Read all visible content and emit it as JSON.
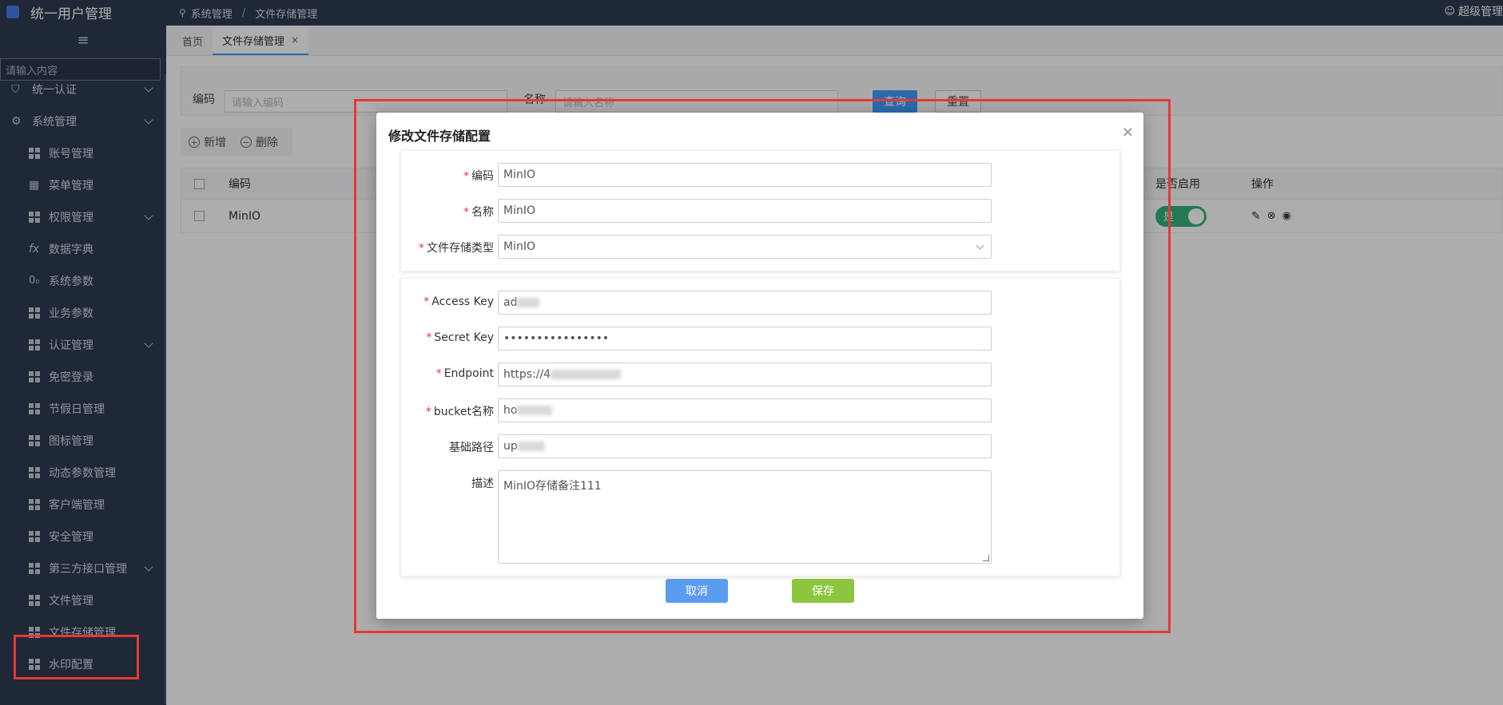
{
  "app": {
    "title": "统一用户管理"
  },
  "sidebar": {
    "search_placeholder": "请输入内容",
    "items": [
      {
        "label": "统一认证",
        "level": "top",
        "icon": "shield-icon",
        "expandable": true
      },
      {
        "label": "系统管理",
        "level": "top",
        "icon": "gear-icon",
        "expandable": true
      },
      {
        "label": "账号管理",
        "level": "sub",
        "icon": "grid-icon",
        "expandable": false
      },
      {
        "label": "菜单管理",
        "level": "sub",
        "icon": "table-icon",
        "expandable": false
      },
      {
        "label": "权限管理",
        "level": "sub",
        "icon": "grid-icon",
        "expandable": true
      },
      {
        "label": "数据字典",
        "level": "sub",
        "icon": "fx-icon",
        "expandable": false
      },
      {
        "label": "系统参数",
        "level": "sub",
        "icon": "toggle-icon",
        "expandable": false
      },
      {
        "label": "业务参数",
        "level": "sub",
        "icon": "grid-icon",
        "expandable": false
      },
      {
        "label": "认证管理",
        "level": "sub",
        "icon": "grid-icon",
        "expandable": true
      },
      {
        "label": "免密登录",
        "level": "sub",
        "icon": "grid-icon",
        "expandable": false
      },
      {
        "label": "节假日管理",
        "level": "sub",
        "icon": "grid-icon",
        "expandable": false
      },
      {
        "label": "图标管理",
        "level": "sub",
        "icon": "grid-icon",
        "expandable": false
      },
      {
        "label": "动态参数管理",
        "level": "sub",
        "icon": "grid-icon",
        "expandable": false
      },
      {
        "label": "客户端管理",
        "level": "sub",
        "icon": "grid-icon",
        "expandable": false
      },
      {
        "label": "安全管理",
        "level": "sub",
        "icon": "grid-icon",
        "expandable": false
      },
      {
        "label": "第三方接口管理",
        "level": "sub",
        "icon": "grid-icon",
        "expandable": true
      },
      {
        "label": "文件管理",
        "level": "sub",
        "icon": "grid-icon",
        "expandable": false
      },
      {
        "label": "文件存储管理",
        "level": "sub",
        "icon": "grid-icon",
        "expandable": false
      },
      {
        "label": "水印配置",
        "level": "sub",
        "icon": "grid-icon",
        "expandable": false
      }
    ]
  },
  "header": {
    "breadcrumb": [
      "系统管理",
      "文件存储管理"
    ],
    "breadcrumb_sep": "/",
    "user": "超级管理"
  },
  "tabs": [
    {
      "label": "首页"
    },
    {
      "label": "文件存储管理",
      "close": "×"
    }
  ],
  "filter": {
    "code_label": "编码",
    "code_placeholder": "请输入编码",
    "name_label": "名称",
    "name_placeholder": "请输入名称",
    "query_button": "查询",
    "reset_button": "重置"
  },
  "toolbar": {
    "add_label": "新增",
    "delete_label": "删除"
  },
  "table": {
    "columns": {
      "code": "编码",
      "enabled": "是否启用",
      "actions": "操作"
    },
    "rows": [
      {
        "code": "MinIO",
        "enabled": "是"
      }
    ]
  },
  "dialog": {
    "title": "修改文件存储配置",
    "close": "×",
    "fields": {
      "code": {
        "label": "编码",
        "value": "MinIO"
      },
      "name": {
        "label": "名称",
        "value": "MinIO"
      },
      "type": {
        "label": "文件存储类型",
        "value": "MinIO"
      },
      "access_key": {
        "label": "Access Key",
        "value": "ad"
      },
      "secret_key": {
        "label": "Secret Key",
        "value": "••••••••••••••••"
      },
      "endpoint": {
        "label": "Endpoint",
        "value": "https://4"
      },
      "bucket": {
        "label": "bucket名称",
        "value": "ho"
      },
      "base_path": {
        "label": "基础路径",
        "value": "up"
      },
      "description": {
        "label": "描述",
        "value": "MinIO存储备注111"
      }
    },
    "cancel_button": "取消",
    "save_button": "保存"
  },
  "colors": {
    "sidebar_bg": "#2f3b52",
    "accent": "#409eff",
    "cancel_btn": "#5b9bf0",
    "save_btn": "#8cc63f",
    "toggle_on": "#36b37e",
    "annotation_red": "#e53935"
  }
}
